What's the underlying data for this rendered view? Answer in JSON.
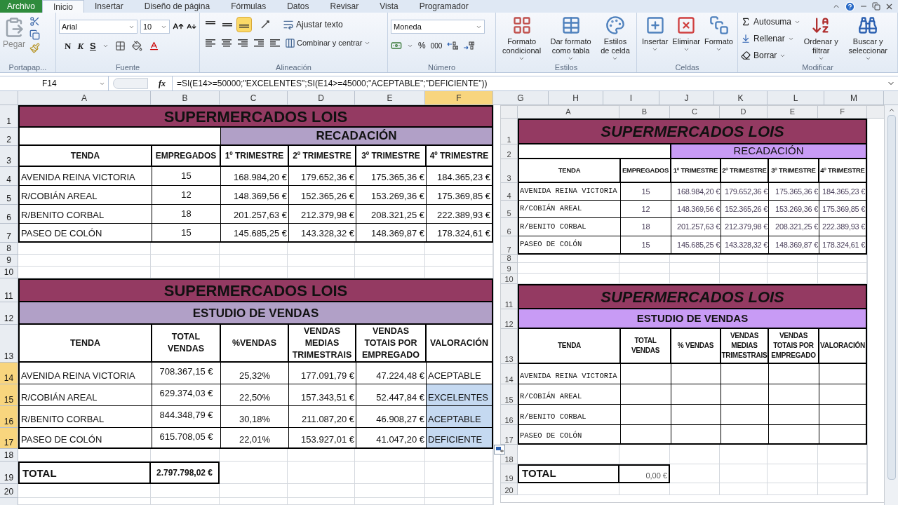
{
  "ribbon": {
    "tabs": [
      {
        "label": "Archivo",
        "kind": "file",
        "selected": false
      },
      {
        "label": "Inicio",
        "kind": "tab",
        "selected": true
      },
      {
        "label": "Insertar",
        "kind": "tab",
        "selected": false
      },
      {
        "label": "Diseño de página",
        "kind": "tab",
        "selected": false
      },
      {
        "label": "Fórmulas",
        "kind": "tab",
        "selected": false
      },
      {
        "label": "Datos",
        "kind": "tab",
        "selected": false
      },
      {
        "label": "Revisar",
        "kind": "tab",
        "selected": false
      },
      {
        "label": "Vista",
        "kind": "tab",
        "selected": false
      },
      {
        "label": "Programador",
        "kind": "tab",
        "selected": false
      }
    ],
    "clipboard": {
      "paste": "Pegar",
      "label": "Portapap..."
    },
    "font": {
      "name": "Arial",
      "size": "10",
      "bold": "N",
      "italic": "K",
      "underline": "S",
      "label": "Fuente"
    },
    "alignment": {
      "vertical": [
        {
          "selected": false
        },
        {
          "selected": false
        },
        {
          "selected": true
        }
      ],
      "wrap": "Ajustar texto",
      "merge": "Combinar y centrar",
      "label": "Alineación"
    },
    "number": {
      "format": "Moneda",
      "percent": "%",
      "thousands": "000",
      "label": "Número"
    },
    "styles": {
      "buttons": [
        "Formato condicional",
        "Dar formato como tabla",
        "Estilos de celda"
      ],
      "label": "Estilos"
    },
    "cells": {
      "buttons": [
        "Insertar",
        "Eliminar",
        "Formato"
      ],
      "label": "Celdas"
    },
    "editing": {
      "small": [
        "Autosuma",
        "Rellenar",
        "Borrar"
      ],
      "large": [
        "Ordenar y filtrar",
        "Buscar y seleccionar"
      ],
      "label": "Modificar"
    }
  },
  "formula_bar": {
    "name_box": "F14",
    "fx": "fx",
    "formula": "=SI(E14>=50000;\"EXCELENTES\";SI(E14>=45000;\"ACEPTABLE\";\"DEFICIENTE\"))"
  },
  "sheet": {
    "columns": [
      {
        "label": "A",
        "selected": false
      },
      {
        "label": "B",
        "selected": false
      },
      {
        "label": "C",
        "selected": false
      },
      {
        "label": "D",
        "selected": false
      },
      {
        "label": "E",
        "selected": false
      },
      {
        "label": "F",
        "selected": true
      },
      {
        "label": "G",
        "selected": false
      },
      {
        "label": "H",
        "selected": false
      },
      {
        "label": "I",
        "selected": false
      },
      {
        "label": "J",
        "selected": false
      },
      {
        "label": "K",
        "selected": false
      },
      {
        "label": "L",
        "selected": false
      },
      {
        "label": "M",
        "selected": false
      }
    ],
    "rows": [
      {
        "label": "1",
        "selected": false
      },
      {
        "label": "2",
        "selected": false
      },
      {
        "label": "3",
        "selected": false
      },
      {
        "label": "4",
        "selected": false
      },
      {
        "label": "5",
        "selected": false
      },
      {
        "label": "6",
        "selected": false
      },
      {
        "label": "7",
        "selected": false
      },
      {
        "label": "8",
        "selected": false
      },
      {
        "label": "9",
        "selected": false
      },
      {
        "label": "10",
        "selected": false
      },
      {
        "label": "11",
        "selected": false
      },
      {
        "label": "12",
        "selected": false
      },
      {
        "label": "13",
        "selected": false
      },
      {
        "label": "14",
        "selected": true
      },
      {
        "label": "15",
        "selected": true
      },
      {
        "label": "16",
        "selected": true
      },
      {
        "label": "17",
        "selected": true
      },
      {
        "label": "18",
        "selected": false
      },
      {
        "label": "19",
        "selected": false
      },
      {
        "label": "20",
        "selected": false
      }
    ],
    "table_1": {
      "title": "SUPERMERCADOS LOIS",
      "subtitle": "RECADACIÓN",
      "headers": [
        "TENDA",
        "EMPREGADOS",
        "1º TRIMESTRE",
        "2º TRIMESTRE",
        "3º TRIMESTRE",
        "4º TRIMESTRE"
      ],
      "rows": [
        [
          "AVENIDA REINA VICTORIA",
          "15",
          "168.984,20 €",
          "179.652,36 €",
          "175.365,36 €",
          "184.365,23 €"
        ],
        [
          "R/COBIÁN AREAL",
          "12",
          "148.369,56 €",
          "152.365,26 €",
          "153.269,36 €",
          "175.369,85 €"
        ],
        [
          "R/BENITO CORBAL",
          "18",
          "201.257,63 €",
          "212.379,98 €",
          "208.321,25 €",
          "222.389,93 €"
        ],
        [
          "PASEO DE COLÓN",
          "15",
          "145.685,25 €",
          "143.328,32 €",
          "148.369,87 €",
          "178.324,61 €"
        ]
      ]
    },
    "table_2": {
      "title": "SUPERMERCADOS LOIS",
      "subtitle": "ESTUDIO DE VENDAS",
      "headers": [
        "TENDA",
        "TOTAL VENDAS",
        "%VENDAS",
        "VENDAS MEDIAS TRIMESTRAIS",
        "VENDAS TOTAIS POR EMPREGADO",
        "VALORACIÓN"
      ],
      "rows": [
        {
          "cells": [
            "AVENIDA REINA VICTORIA",
            "708.367,15 €",
            "25,32%",
            "177.091,79 €",
            "47.224,48 €"
          ],
          "valoracion": "ACEPTABLE",
          "selected": false
        },
        {
          "cells": [
            "R/COBIÁN AREAL",
            "629.374,03 €",
            "22,50%",
            "157.343,51 €",
            "52.447,84 €"
          ],
          "valoracion": "EXCELENTES",
          "selected": true
        },
        {
          "cells": [
            "R/BENITO CORBAL",
            "844.348,79 €",
            "30,18%",
            "211.087,20 €",
            "46.908,27 €"
          ],
          "valoracion": "ACEPTABLE",
          "selected": true
        },
        {
          "cells": [
            "PASEO DE COLÓN",
            "615.708,05 €",
            "22,01%",
            "153.927,01 €",
            "41.047,20 €"
          ],
          "valoracion": "DEFICIENTE",
          "selected": true
        }
      ]
    },
    "total": {
      "label": "TOTAL",
      "value": "2.797.798,02 €"
    }
  },
  "pasted_picture": {
    "columns": [
      "A",
      "B",
      "C",
      "D",
      "E",
      "F"
    ],
    "rows": [
      "1",
      "2",
      "3",
      "4",
      "5",
      "6",
      "7",
      "8",
      "9",
      "10",
      "11",
      "12",
      "13",
      "14",
      "15",
      "16",
      "17",
      "18",
      "19",
      "20"
    ],
    "table_1": {
      "title": "SUPERMERCADOS LOIS",
      "subtitle": "RECADACIÓN",
      "headers": [
        "TENDA",
        "EMPREGADOS",
        "1º TRIMESTRE",
        "2º TRIMESTRE",
        "3º TRIMESTRE",
        "4º TRIMESTRE"
      ],
      "rows": [
        [
          "AVENIDA REINA VICTORIA",
          "15",
          "168.984,20 €",
          "179.652,36 €",
          "175.365,36 €",
          "184.365,23 €"
        ],
        [
          "R/COBIÁN AREAL",
          "12",
          "148.369,56 €",
          "152.365,26 €",
          "153.269,36 €",
          "175.369,85 €"
        ],
        [
          "R/BENITO CORBAL",
          "18",
          "201.257,63 €",
          "212.379,98 €",
          "208.321,25 €",
          "222.389,93 €"
        ],
        [
          "PASEO DE COLÓN",
          "15",
          "145.685,25 €",
          "143.328,32 €",
          "148.369,87 €",
          "178.324,61 €"
        ]
      ]
    },
    "table_2": {
      "title": "SUPERMERCADOS LOIS",
      "subtitle": "ESTUDIO DE VENDAS",
      "headers": [
        "TENDA",
        "TOTAL VENDAS",
        "% VENDAS",
        "VENDAS MEDIAS TRIMESTRAIS",
        "VENDAS TOTAIS POR EMPREGADO",
        "VALORACIÓN"
      ],
      "rows": [
        "AVENIDA REINA VICTORIA",
        "R/COBIÁN AREAL",
        "R/BENITO CORBAL",
        "PASEO DE COLÓN"
      ]
    },
    "total": {
      "label": "TOTAL",
      "value": "0,00 €"
    }
  }
}
